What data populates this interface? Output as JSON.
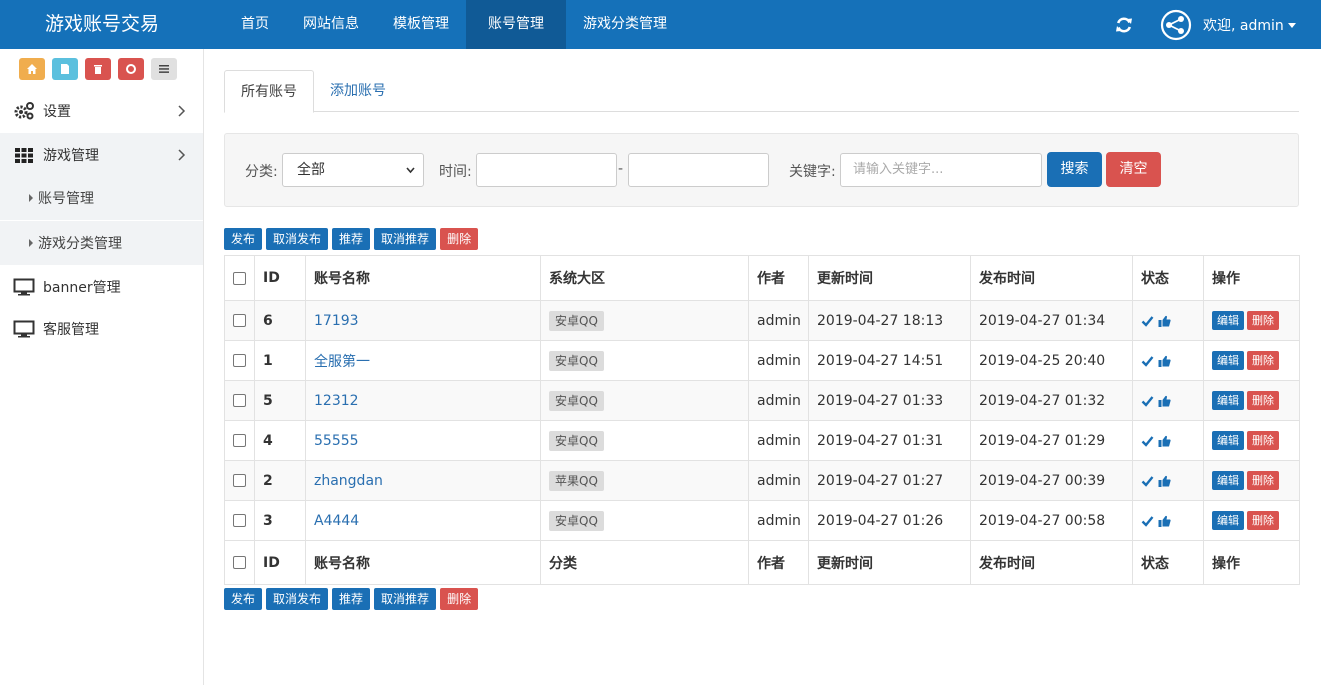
{
  "brand": "游戏账号交易",
  "topnav": [
    {
      "label": "首页"
    },
    {
      "label": "网站信息"
    },
    {
      "label": "模板管理"
    },
    {
      "label": "账号管理",
      "active": true
    },
    {
      "label": "游戏分类管理"
    }
  ],
  "user_menu": "欢迎, admin",
  "colors": {
    "primary": "#1571b9",
    "danger": "#d9534f",
    "quick_orange": "#f0ad4e",
    "quick_blue": "#5bc0de",
    "quick_red": "#d9534f",
    "quick_grey": "#e0e0e0"
  },
  "quick_icons": [
    "home-icon",
    "file-icon",
    "trash-icon",
    "recycle-icon",
    "list-icon"
  ],
  "sidebar": {
    "items": [
      {
        "label": "设置",
        "icon": "gears-icon"
      },
      {
        "label": "游戏管理",
        "icon": "grid-icon"
      },
      {
        "label": "账号管理"
      },
      {
        "label": "游戏分类管理"
      },
      {
        "label": "banner管理",
        "icon": "monitor-icon"
      },
      {
        "label": "客服管理",
        "icon": "monitor-icon"
      }
    ]
  },
  "tabs": {
    "all": "所有账号",
    "add": "添加账号"
  },
  "filter": {
    "category_label": "分类:",
    "category_value": "全部",
    "time_label": "时间:",
    "time_sep": "-",
    "keyword_label": "关键字:",
    "keyword_placeholder": "请输入关键字...",
    "search_btn": "搜索",
    "clear_btn": "清空"
  },
  "actions": {
    "publish": "发布",
    "unpublish": "取消发布",
    "recommend": "推荐",
    "unrecommend": "取消推荐",
    "delete": "删除"
  },
  "table": {
    "headers": {
      "id": "ID",
      "name": "账号名称",
      "region": "系统大区",
      "author": "作者",
      "updated": "更新时间",
      "published": "发布时间",
      "status": "状态",
      "ops": "操作"
    },
    "footer": {
      "id": "ID",
      "name": "账号名称",
      "category": "分类",
      "author": "作者",
      "updated": "更新时间",
      "published": "发布时间",
      "status": "状态",
      "ops": "操作"
    },
    "rows": [
      {
        "id": "6",
        "name": "17193",
        "region": "安卓QQ",
        "author": "admin",
        "updated": "2019-04-27 18:13",
        "published": "2019-04-27 01:34"
      },
      {
        "id": "1",
        "name": "全服第一",
        "region": "安卓QQ",
        "author": "admin",
        "updated": "2019-04-27 14:51",
        "published": "2019-04-25 20:40"
      },
      {
        "id": "5",
        "name": "12312",
        "region": "安卓QQ",
        "author": "admin",
        "updated": "2019-04-27 01:33",
        "published": "2019-04-27 01:32"
      },
      {
        "id": "4",
        "name": "55555",
        "region": "安卓QQ",
        "author": "admin",
        "updated": "2019-04-27 01:31",
        "published": "2019-04-27 01:29"
      },
      {
        "id": "2",
        "name": "zhangdan",
        "region": "苹果QQ",
        "author": "admin",
        "updated": "2019-04-27 01:27",
        "published": "2019-04-27 00:39"
      },
      {
        "id": "3",
        "name": "A4444",
        "region": "安卓QQ",
        "author": "admin",
        "updated": "2019-04-27 01:26",
        "published": "2019-04-27 00:58"
      }
    ],
    "row_edit": "编辑",
    "row_delete": "删除"
  }
}
